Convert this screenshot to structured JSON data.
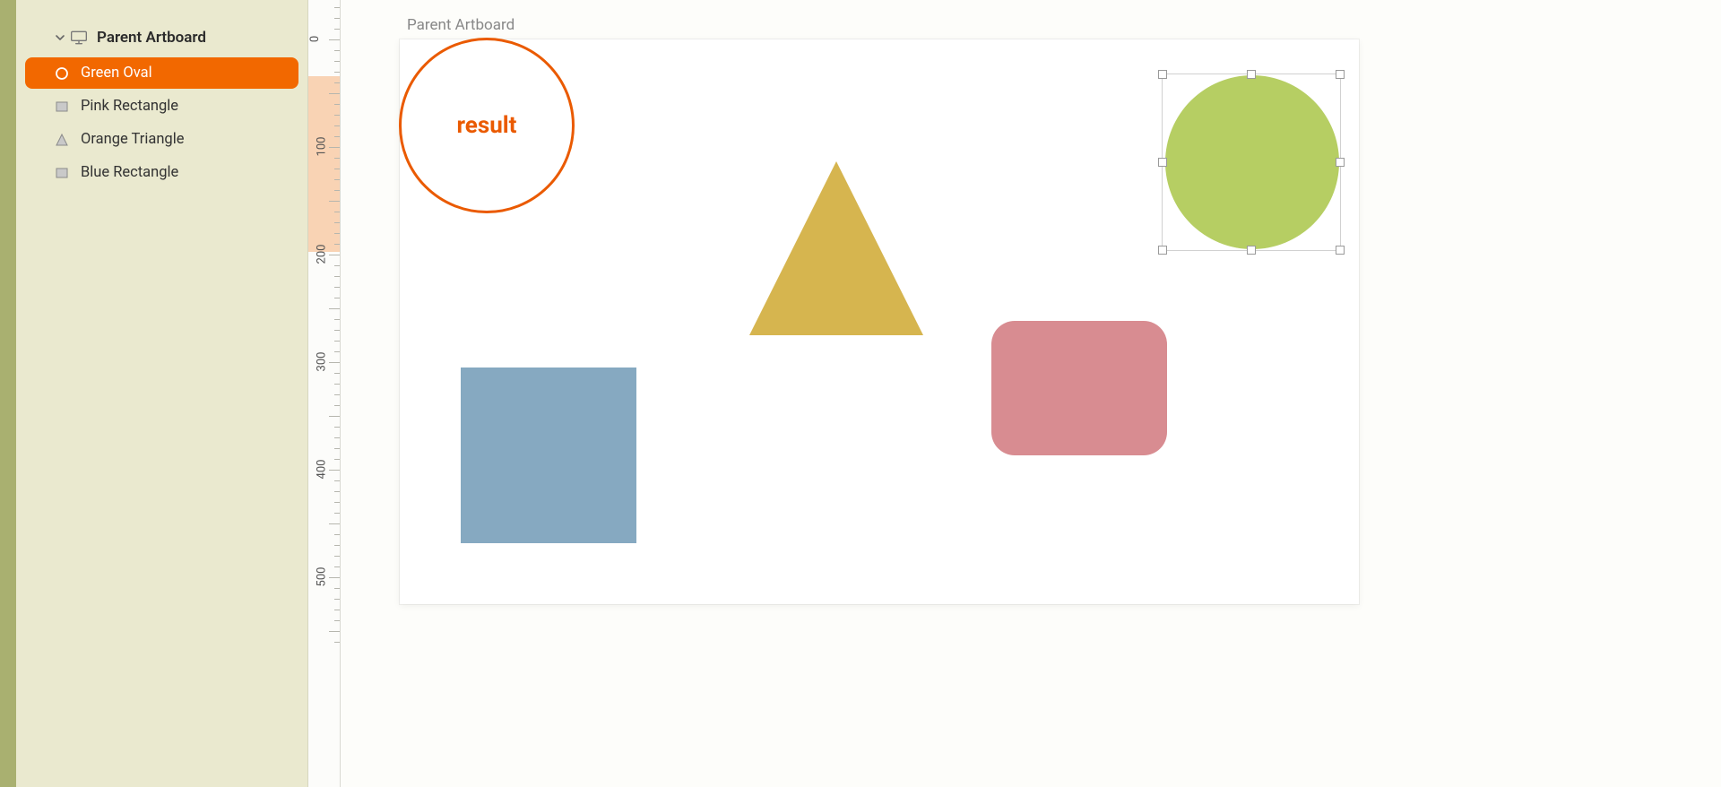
{
  "sidebar": {
    "artboard_title": "Parent Artboard",
    "layers": [
      {
        "label": "Green Oval",
        "icon": "circle",
        "selected": true
      },
      {
        "label": "Pink Rectangle",
        "icon": "rect",
        "selected": false
      },
      {
        "label": "Orange Triangle",
        "icon": "triangle",
        "selected": false
      },
      {
        "label": "Blue Rectangle",
        "icon": "rect",
        "selected": false
      }
    ]
  },
  "ruler": {
    "labels": [
      "0",
      "100",
      "200",
      "300",
      "400",
      "500"
    ]
  },
  "canvas": {
    "artboard_label": "Parent Artboard",
    "callout_text": "result"
  },
  "colors": {
    "accent": "#f26800",
    "oval": "#b6ce63",
    "triangle": "#d6b54f",
    "roundrect": "#d88c91",
    "rect": "#86a9c1"
  }
}
